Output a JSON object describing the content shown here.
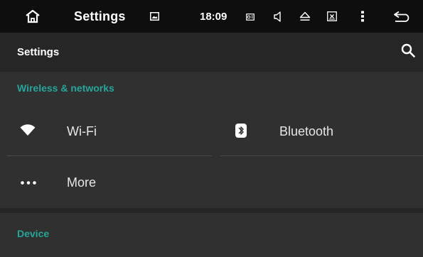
{
  "status_bar": {
    "title": "Settings",
    "time": "18:09",
    "icons": [
      "home-icon",
      "gallery-icon",
      "radio-icon",
      "volume-icon",
      "eject-icon",
      "close-box-icon",
      "overflow-menu-icon",
      "back-icon"
    ]
  },
  "action_bar": {
    "title": "Settings",
    "search_icon": "search-icon"
  },
  "sections": [
    {
      "header": "Wireless & networks",
      "items": [
        {
          "label": "Wi-Fi",
          "icon": "wifi-icon"
        },
        {
          "label": "Bluetooth",
          "icon": "bluetooth-icon"
        },
        {
          "label": "More",
          "icon": "more-dots-icon"
        }
      ]
    },
    {
      "header": "Device",
      "items": []
    }
  ],
  "colors": {
    "status_bar_bg": "#0e0e0e",
    "action_bar_bg": "#262626",
    "content_bg": "#303030",
    "section_header": "#26a69a",
    "item_text": "#e6e6e6"
  }
}
